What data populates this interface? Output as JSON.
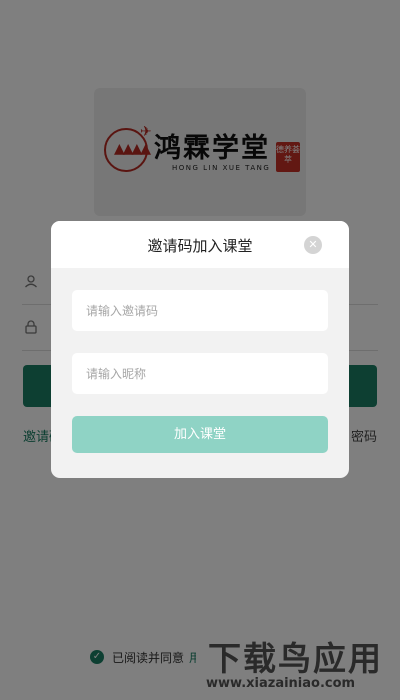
{
  "logo": {
    "title": "鸿霖学堂",
    "subtitle": "HONG LIN XUE TANG",
    "seal": "德养荟萃",
    "trees_glyph": "▲▲▲▲",
    "bird_glyph": "✈"
  },
  "login": {
    "user_icon": "user-icon",
    "lock_icon": "lock-icon",
    "invite_link_label": "邀请码",
    "forgot_link_label": "密码"
  },
  "agreement": {
    "text": "已阅读并同意",
    "link": "用",
    "check_icon": "check-circle-icon"
  },
  "watermark": {
    "title": "下载鸟应用",
    "url": "www.xiazainiao.com"
  },
  "dialog": {
    "title": "邀请码加入课堂",
    "close_icon": "close-icon",
    "invite_placeholder": "请输入邀请码",
    "nickname_placeholder": "请输入昵称",
    "submit_label": "加入课堂"
  },
  "colors": {
    "accent": "#1a7f64",
    "button_disabled": "#8fd3c5",
    "overlay": "#000000"
  }
}
